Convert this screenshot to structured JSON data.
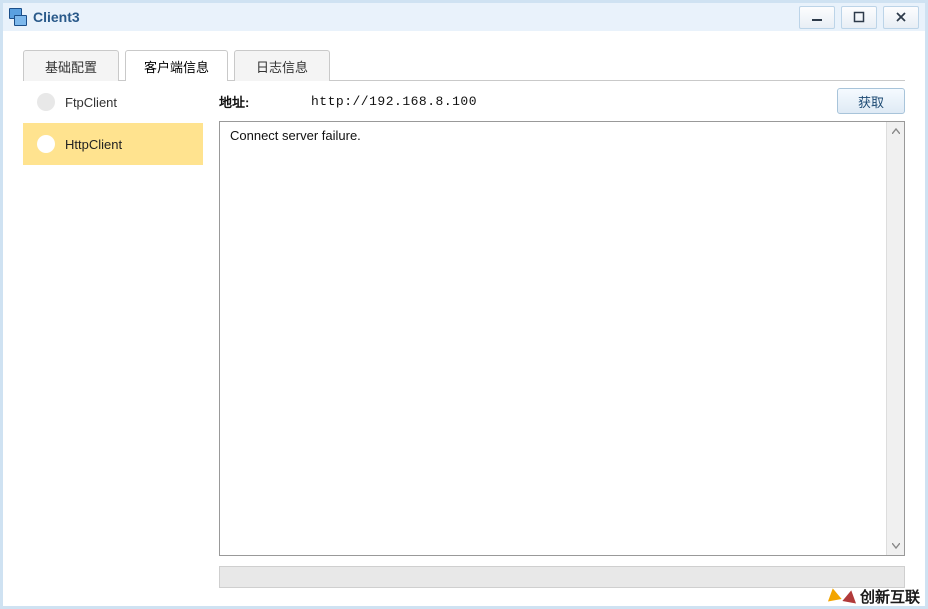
{
  "window": {
    "title": "Client3"
  },
  "tabs": [
    {
      "label": "基础配置"
    },
    {
      "label": "客户端信息"
    },
    {
      "label": "日志信息"
    }
  ],
  "active_tab_index": 1,
  "sidebar": {
    "items": [
      {
        "label": "FtpClient"
      },
      {
        "label": "HttpClient"
      }
    ],
    "selected_index": 1
  },
  "address": {
    "label": "地址:",
    "value": "http://192.168.8.100"
  },
  "actions": {
    "fetch_label": "获取"
  },
  "log": {
    "content": "Connect server failure."
  },
  "watermark": {
    "text": "创新互联"
  }
}
